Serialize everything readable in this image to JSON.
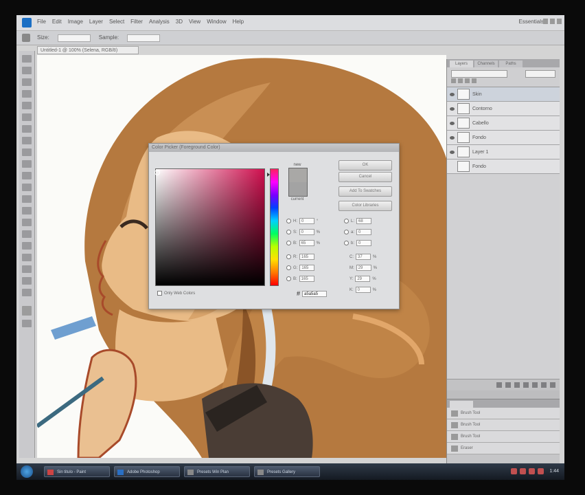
{
  "window": {
    "menu_items": [
      "File",
      "Edit",
      "Image",
      "Layer",
      "Select",
      "Filter",
      "Analysis",
      "3D",
      "View",
      "Window",
      "Help"
    ],
    "workspace": "Essentials",
    "options_labels": [
      "Size:",
      "Sample:"
    ],
    "document_tab": "Untitled-1 @ 100% (Selena, RGB/8)"
  },
  "color_picker": {
    "title": "Color Picker (Foreground Color)",
    "swatch_new_label": "new",
    "swatch_current_label": "current",
    "ok_label": "OK",
    "cancel_label": "Cancel",
    "add_swatches_label": "Add To Swatches",
    "libraries_label": "Color Libraries",
    "only_web_label": "Only Web Colors",
    "hsb": [
      {
        "label": "H:",
        "value": "0",
        "unit": "°"
      },
      {
        "label": "S:",
        "value": "0",
        "unit": "%"
      },
      {
        "label": "B:",
        "value": "65",
        "unit": "%"
      }
    ],
    "rgb": [
      {
        "label": "R:",
        "value": "165"
      },
      {
        "label": "G:",
        "value": "165"
      },
      {
        "label": "B:",
        "value": "165"
      }
    ],
    "lab": [
      {
        "label": "L:",
        "value": "68"
      },
      {
        "label": "a:",
        "value": "0"
      },
      {
        "label": "b:",
        "value": "0"
      }
    ],
    "cmyk": [
      {
        "label": "C:",
        "value": "37",
        "unit": "%"
      },
      {
        "label": "M:",
        "value": "29",
        "unit": "%"
      },
      {
        "label": "Y:",
        "value": "29",
        "unit": "%"
      },
      {
        "label": "K:",
        "value": "0",
        "unit": "%"
      }
    ],
    "hex_label": "#",
    "hex_value": "a5a5a5"
  },
  "layers_panel": {
    "tabs": [
      "Layers",
      "Channels",
      "Paths"
    ],
    "layers": [
      {
        "name": "Skin"
      },
      {
        "name": "Contorno"
      },
      {
        "name": "Cabello"
      },
      {
        "name": "Fondo"
      },
      {
        "name": "Layer 1"
      },
      {
        "name": "Fondo"
      }
    ]
  },
  "history_panel": {
    "items": [
      "Brush Tool",
      "Brush Tool",
      "Brush Tool",
      "Eraser"
    ]
  },
  "taskbar": {
    "buttons": [
      {
        "label": "Sin titulo - Paint"
      },
      {
        "label": "Adobe Photoshop"
      },
      {
        "label": "Presets Win Plan"
      },
      {
        "label": "Presets Gallery"
      }
    ],
    "clock": "1:44"
  },
  "colors": {
    "hair": "#b5793f",
    "hair_dark": "#8a5427",
    "skin": "#e9bb86",
    "outline": "#a84a2a",
    "picker_hue": "#cf0f4e"
  }
}
